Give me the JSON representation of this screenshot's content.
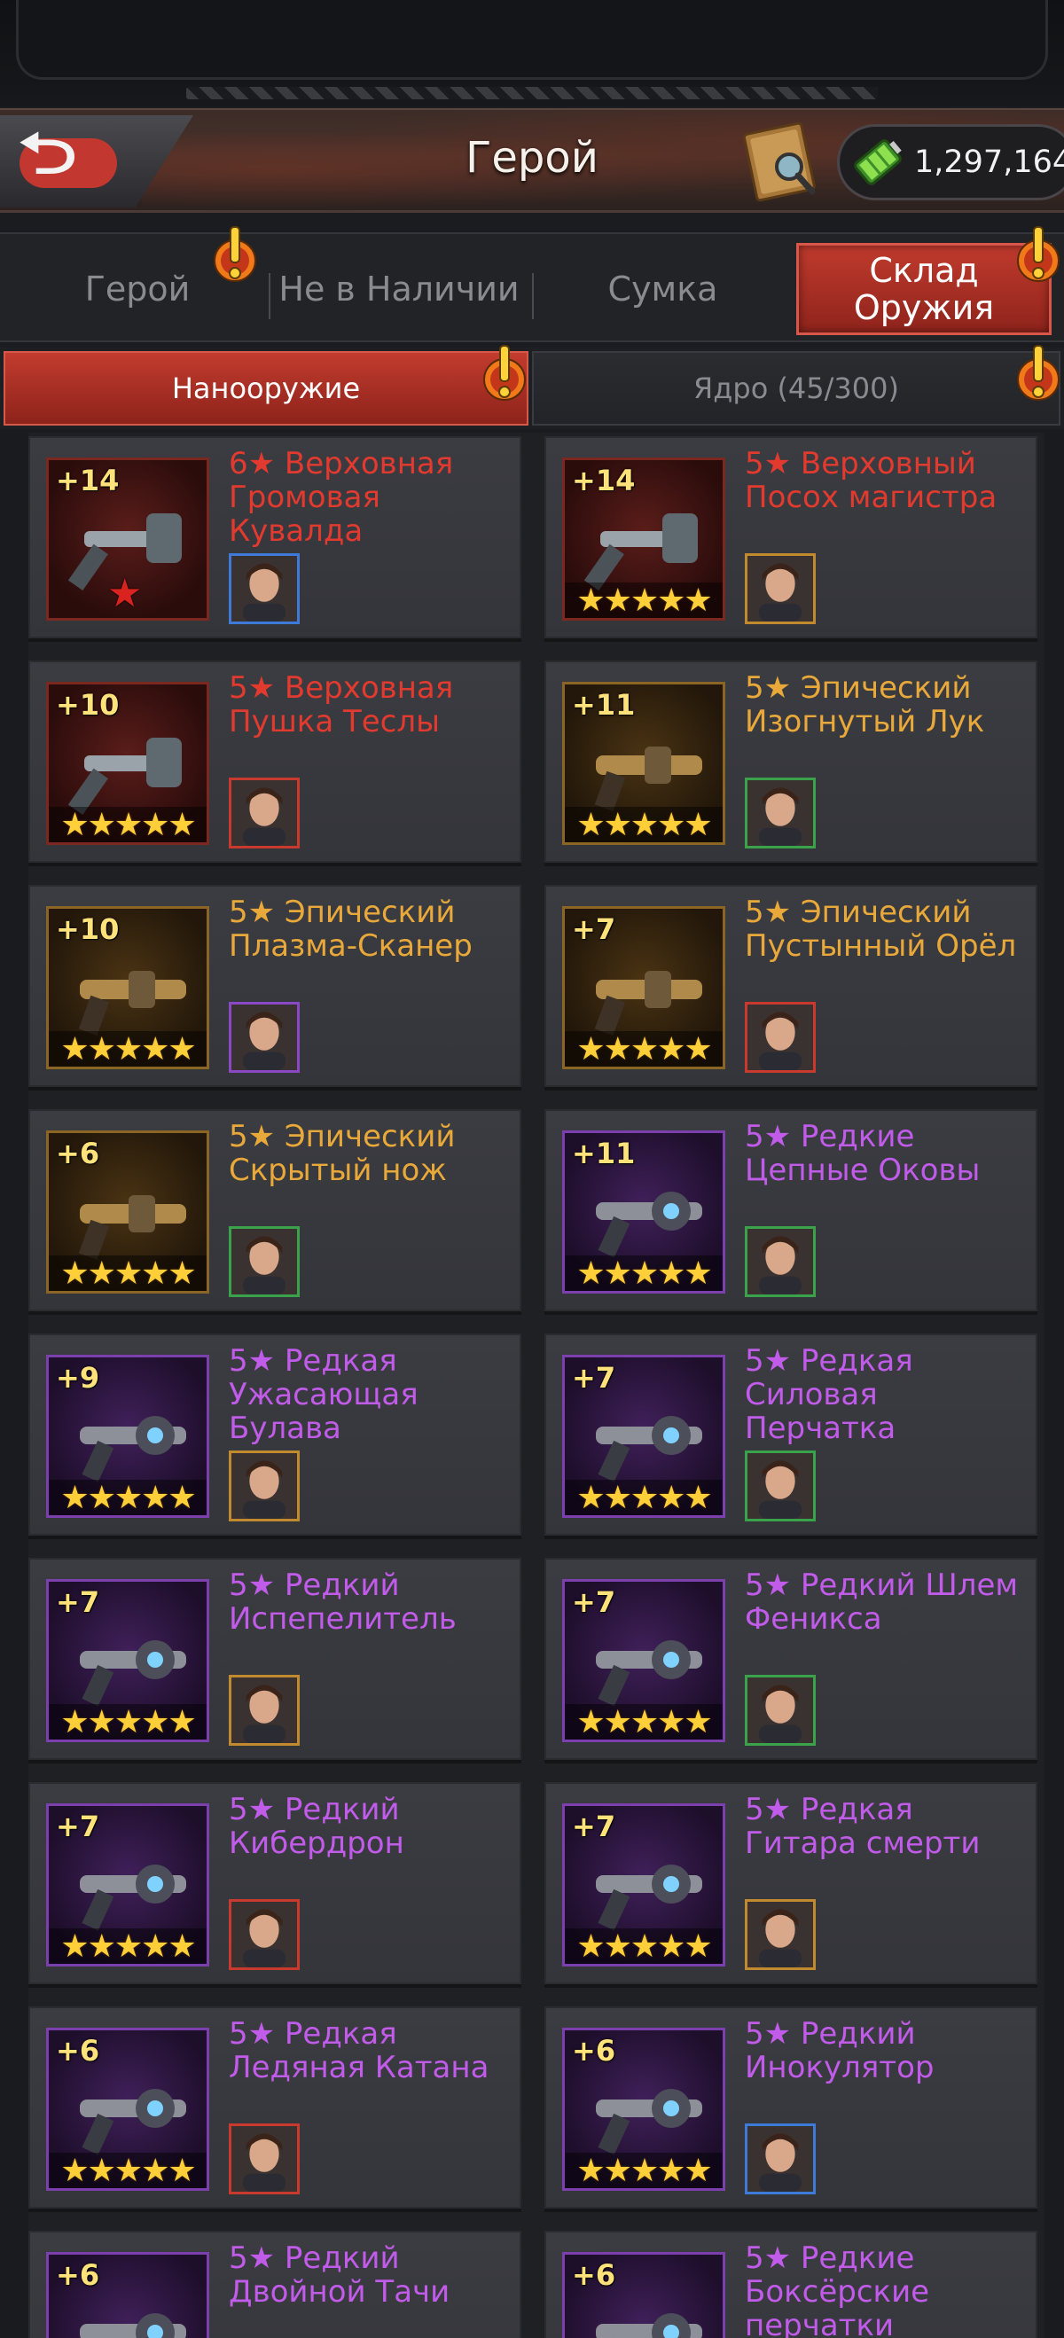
{
  "header": {
    "title": "Герой",
    "currency_amount": "1,297,164",
    "currency_icon": "battery-icon",
    "back_icon": "back-arrow-icon",
    "book_icon": "manual-icon"
  },
  "tabs": [
    {
      "label": "Герой",
      "alert": true
    },
    {
      "label": "Не в Наличии",
      "alert": false
    },
    {
      "label": "Сумка",
      "alert": false
    },
    {
      "label": "Склад Оружия",
      "alert": true,
      "active": true
    }
  ],
  "subtabs": [
    {
      "label": "Нанооружие",
      "alert": true,
      "active": true
    },
    {
      "label": "Ядро (45/300)",
      "alert": true,
      "active": false
    }
  ],
  "colors": {
    "legendary": "#e23a2f",
    "epic": "#e9a93a",
    "rare": "#c15be9",
    "accent_tab": "#b23226",
    "star": "#ffcf3a"
  },
  "weapons": [
    {
      "level": "+14",
      "name": "6★ Верховная Громовая Кувалда",
      "rarity": "red",
      "stars": "",
      "red_star": "★",
      "avatar_border": "b-blue",
      "weapon_icon": "hammer-icon",
      "avatar_icon": "helmet-avatar"
    },
    {
      "level": "+14",
      "name": "5★ Верховный Посох магистра",
      "rarity": "red",
      "stars": "★★★★★",
      "red_star": "",
      "avatar_border": "b-gold",
      "weapon_icon": "staff-icon",
      "avatar_icon": "bald-woman-avatar"
    },
    {
      "level": "+10",
      "name": "5★ Верховная Пушка Теслы",
      "rarity": "red",
      "stars": "★★★★★",
      "red_star": "",
      "avatar_border": "b-red",
      "weapon_icon": "tesla-cannon-icon",
      "avatar_icon": "dark-hair-woman-avatar"
    },
    {
      "level": "+11",
      "name": "5★ Эпический Изогнутый Лук",
      "rarity": "gold",
      "stars": "★★★★★",
      "red_star": "",
      "avatar_border": "b-green",
      "weapon_icon": "bow-icon",
      "avatar_icon": "brunette-woman-avatar"
    },
    {
      "level": "+10",
      "name": "5★ Эпический Плазма-Сканер",
      "rarity": "gold",
      "stars": "★★★★★",
      "red_star": "",
      "avatar_border": "b-purple",
      "weapon_icon": "scanner-icon",
      "avatar_icon": "woman-avatar"
    },
    {
      "level": "+7",
      "name": "5★ Эпический Пустынный Орёл",
      "rarity": "gold",
      "stars": "★★★★★",
      "red_star": "",
      "avatar_border": "b-red",
      "weapon_icon": "pistol-icon",
      "avatar_icon": "cowboy-avatar"
    },
    {
      "level": "+6",
      "name": "5★ Эпический Скрытый нож",
      "rarity": "gold",
      "stars": "★★★★★",
      "red_star": "",
      "avatar_border": "b-green",
      "weapon_icon": "knife-icon",
      "avatar_icon": "man-avatar"
    },
    {
      "level": "+11",
      "name": "5★ Редкие Цепные Оковы",
      "rarity": "purple",
      "stars": "★★★★★",
      "red_star": "",
      "avatar_border": "b-green",
      "weapon_icon": "chain-icon",
      "avatar_icon": "masked-woman-avatar"
    },
    {
      "level": "+9",
      "name": "5★ Редкая Ужасающая Булава",
      "rarity": "purple",
      "stars": "★★★★★",
      "red_star": "",
      "avatar_border": "b-gold",
      "weapon_icon": "mace-icon",
      "avatar_icon": "soldier-avatar"
    },
    {
      "level": "+7",
      "name": "5★ Редкая Силовая Перчатка",
      "rarity": "purple",
      "stars": "★★★★★",
      "red_star": "",
      "avatar_border": "b-green",
      "weapon_icon": "glove-icon",
      "avatar_icon": "sunglasses-man-avatar"
    },
    {
      "level": "+7",
      "name": "5★ Редкий Испепелитель",
      "rarity": "purple",
      "stars": "★★★★★",
      "red_star": "",
      "avatar_border": "b-gold",
      "weapon_icon": "flamethrower-icon",
      "avatar_icon": "redhead-woman-avatar"
    },
    {
      "level": "+7",
      "name": "5★ Редкий Шлем Феникса",
      "rarity": "purple",
      "stars": "★★★★★",
      "red_star": "",
      "avatar_border": "b-green",
      "weapon_icon": "phoenix-helmet-icon",
      "avatar_icon": "man-avatar"
    },
    {
      "level": "+7",
      "name": "5★ Редкий Кибердрон",
      "rarity": "purple",
      "stars": "★★★★★",
      "red_star": "",
      "avatar_border": "b-red",
      "weapon_icon": "drone-icon",
      "avatar_icon": "hat-woman-avatar"
    },
    {
      "level": "+7",
      "name": "5★ Редкая Гитара смерти",
      "rarity": "purple",
      "stars": "★★★★★",
      "red_star": "",
      "avatar_border": "b-gold",
      "weapon_icon": "guitar-icon",
      "avatar_icon": "blonde-woman-avatar"
    },
    {
      "level": "+6",
      "name": "5★ Редкая Ледяная Катана",
      "rarity": "purple",
      "stars": "★★★★★",
      "red_star": "",
      "avatar_border": "b-red",
      "weapon_icon": "katana-icon",
      "avatar_icon": "dark-woman-avatar"
    },
    {
      "level": "+6",
      "name": "5★ Редкий Инокулятор",
      "rarity": "purple",
      "stars": "★★★★★",
      "red_star": "",
      "avatar_border": "b-blue",
      "weapon_icon": "inoculator-icon",
      "avatar_icon": "nurse-avatar"
    },
    {
      "level": "+6",
      "name": "5★ Редкий Двойной Тачи",
      "rarity": "purple",
      "stars": "★★★★★",
      "red_star": "",
      "avatar_border": "b-red",
      "weapon_icon": "dual-swords-icon",
      "avatar_icon": "woman-avatar"
    },
    {
      "level": "+6",
      "name": "5★ Редкие Боксёрские перчатки",
      "rarity": "purple",
      "stars": "★★★★★",
      "red_star": "",
      "avatar_border": "b-purple",
      "weapon_icon": "boxing-gloves-icon",
      "avatar_icon": "woman-avatar"
    }
  ]
}
